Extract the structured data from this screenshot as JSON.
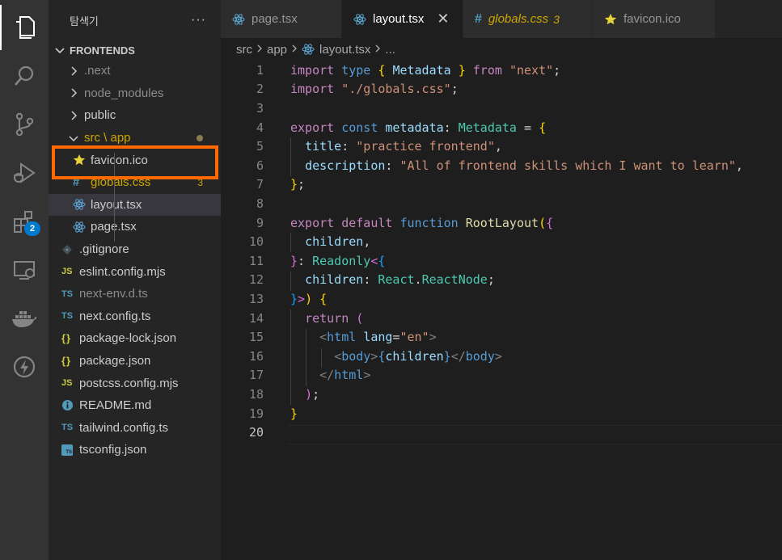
{
  "explorer": {
    "title": "탐색기",
    "more": "···",
    "section": "FRONTENDS",
    "items": [
      {
        "label": ".next",
        "type": "folder",
        "state": "collapsed",
        "style": "dim",
        "icon": "chevron-right-icon"
      },
      {
        "label": "node_modules",
        "type": "folder",
        "state": "collapsed",
        "style": "dim",
        "icon": "chevron-right-icon"
      },
      {
        "label": "public",
        "type": "folder",
        "state": "collapsed",
        "style": "normal",
        "icon": "chevron-right-icon"
      },
      {
        "label": "src \\ app",
        "type": "folder",
        "state": "expanded",
        "style": "warn",
        "icon": "chevron-down-icon"
      },
      {
        "label": "favicon.ico",
        "type": "file",
        "style": "normal",
        "icon": "star-icon"
      },
      {
        "label": "globals.css",
        "type": "file",
        "style": "warn",
        "icon": "css-hash-icon",
        "badge": "3"
      },
      {
        "label": "layout.tsx",
        "type": "file",
        "style": "normal",
        "icon": "react-icon",
        "selected": true
      },
      {
        "label": "page.tsx",
        "type": "file",
        "style": "normal",
        "icon": "react-icon"
      },
      {
        "label": ".gitignore",
        "type": "file",
        "style": "normal",
        "icon": "git-diamond-icon"
      },
      {
        "label": "eslint.config.mjs",
        "type": "file",
        "style": "normal",
        "icon": "js-icon",
        "icon_text": "JS"
      },
      {
        "label": "next-env.d.ts",
        "type": "file",
        "style": "dim",
        "icon": "ts-icon",
        "icon_text": "TS"
      },
      {
        "label": "next.config.ts",
        "type": "file",
        "style": "normal",
        "icon": "ts-icon",
        "icon_text": "TS"
      },
      {
        "label": "package-lock.json",
        "type": "file",
        "style": "normal",
        "icon": "json-braces-icon",
        "icon_text": "{}"
      },
      {
        "label": "package.json",
        "type": "file",
        "style": "normal",
        "icon": "json-braces-icon",
        "icon_text": "{}"
      },
      {
        "label": "postcss.config.mjs",
        "type": "file",
        "style": "normal",
        "icon": "js-icon",
        "icon_text": "JS"
      },
      {
        "label": "README.md",
        "type": "file",
        "style": "normal",
        "icon": "info-icon"
      },
      {
        "label": "tailwind.config.ts",
        "type": "file",
        "style": "normal",
        "icon": "ts-icon",
        "icon_text": "TS"
      },
      {
        "label": "tsconfig.json",
        "type": "file",
        "style": "normal",
        "icon": "tsconfig-icon",
        "icon_text": "TS"
      }
    ]
  },
  "activity_bar": {
    "items": [
      "explorer-icon",
      "search-icon",
      "source-control-icon",
      "run-debug-icon",
      "extensions-icon",
      "remote-explorer-icon",
      "docker-icon",
      "lightning-icon"
    ],
    "extensions_badge": "2"
  },
  "tabs": [
    {
      "label": "page.tsx",
      "icon": "react-icon",
      "active": false
    },
    {
      "label": "layout.tsx",
      "icon": "react-icon",
      "active": true,
      "close": "✕"
    },
    {
      "label": "globals.css",
      "icon": "css-hash-icon",
      "active": false,
      "warn": true,
      "count": "3"
    },
    {
      "label": "favicon.ico",
      "icon": "star-icon",
      "active": false
    }
  ],
  "breadcrumb": {
    "parts": [
      "src",
      "app",
      "layout.tsx",
      "..."
    ]
  },
  "editor": {
    "current_line": 20,
    "lines": [
      {
        "n": "1",
        "tokens": [
          [
            "k",
            "import "
          ],
          [
            "b",
            "type "
          ],
          [
            "y",
            "{ "
          ],
          [
            "v",
            "Metadata "
          ],
          [
            "y",
            "} "
          ],
          [
            "k",
            "from "
          ],
          [
            "s",
            "\"next\""
          ],
          [
            "p",
            ";"
          ]
        ]
      },
      {
        "n": "2",
        "tokens": [
          [
            "k",
            "import "
          ],
          [
            "s",
            "\"./globals.css\""
          ],
          [
            "p",
            ";"
          ]
        ]
      },
      {
        "n": "3",
        "tokens": []
      },
      {
        "n": "4",
        "tokens": [
          [
            "k",
            "export "
          ],
          [
            "b",
            "const "
          ],
          [
            "v",
            "metadata"
          ],
          [
            "p",
            ": "
          ],
          [
            "t",
            "Metadata "
          ],
          [
            "p",
            "= "
          ],
          [
            "y",
            "{"
          ]
        ]
      },
      {
        "n": "5",
        "tokens": [
          [
            "p",
            "  "
          ],
          [
            "v",
            "title"
          ],
          [
            "p",
            ": "
          ],
          [
            "s",
            "\"practice frontend\""
          ],
          [
            "p",
            ","
          ]
        ]
      },
      {
        "n": "6",
        "tokens": [
          [
            "p",
            "  "
          ],
          [
            "v",
            "description"
          ],
          [
            "p",
            ": "
          ],
          [
            "s",
            "\"All of frontend skills which I want to learn\""
          ],
          [
            "p",
            ","
          ]
        ]
      },
      {
        "n": "7",
        "tokens": [
          [
            "y",
            "}"
          ],
          [
            "p",
            ";"
          ]
        ]
      },
      {
        "n": "8",
        "tokens": []
      },
      {
        "n": "9",
        "tokens": [
          [
            "k",
            "export "
          ],
          [
            "k",
            "default "
          ],
          [
            "b",
            "function "
          ],
          [
            "f",
            "RootLayout"
          ],
          [
            "y",
            "("
          ],
          [
            "m",
            "{"
          ]
        ]
      },
      {
        "n": "10",
        "tokens": [
          [
            "p",
            "  "
          ],
          [
            "v",
            "children"
          ],
          [
            "p",
            ","
          ]
        ]
      },
      {
        "n": "11",
        "tokens": [
          [
            "m",
            "}"
          ],
          [
            "p",
            ": "
          ],
          [
            "t",
            "Readonly"
          ],
          [
            "m",
            "<"
          ],
          [
            "bl",
            "{"
          ]
        ]
      },
      {
        "n": "12",
        "tokens": [
          [
            "p",
            "  "
          ],
          [
            "v",
            "children"
          ],
          [
            "p",
            ": "
          ],
          [
            "t",
            "React"
          ],
          [
            "p",
            "."
          ],
          [
            "t",
            "ReactNode"
          ],
          [
            "p",
            ";"
          ]
        ]
      },
      {
        "n": "13",
        "tokens": [
          [
            "bl",
            "}"
          ],
          [
            "m",
            ">"
          ],
          [
            "y",
            ")"
          ],
          [
            "p",
            " "
          ],
          [
            "y",
            "{"
          ]
        ]
      },
      {
        "n": "14",
        "tokens": [
          [
            "p",
            "  "
          ],
          [
            "k",
            "return "
          ],
          [
            "m",
            "("
          ]
        ]
      },
      {
        "n": "15",
        "tokens": [
          [
            "p",
            "    "
          ],
          [
            "g",
            "<"
          ],
          [
            "b",
            "html "
          ],
          [
            "v",
            "lang"
          ],
          [
            "p",
            "="
          ],
          [
            "s",
            "\"en\""
          ],
          [
            "g",
            ">"
          ]
        ]
      },
      {
        "n": "16",
        "tokens": [
          [
            "p",
            "      "
          ],
          [
            "g",
            "<"
          ],
          [
            "b",
            "body"
          ],
          [
            "g",
            ">"
          ],
          [
            "b",
            "{"
          ],
          [
            "v",
            "children"
          ],
          [
            "b",
            "}"
          ],
          [
            "g",
            "</"
          ],
          [
            "b",
            "body"
          ],
          [
            "g",
            ">"
          ]
        ]
      },
      {
        "n": "17",
        "tokens": [
          [
            "p",
            "    "
          ],
          [
            "g",
            "</"
          ],
          [
            "b",
            "html"
          ],
          [
            "g",
            ">"
          ]
        ]
      },
      {
        "n": "18",
        "tokens": [
          [
            "p",
            "  "
          ],
          [
            "m",
            ")"
          ],
          [
            "p",
            ";"
          ]
        ]
      },
      {
        "n": "19",
        "tokens": [
          [
            "y",
            "}"
          ]
        ]
      },
      {
        "n": "20",
        "tokens": []
      }
    ]
  },
  "annotation": {
    "target": "favicon.ico",
    "color": "#ff6a00"
  }
}
